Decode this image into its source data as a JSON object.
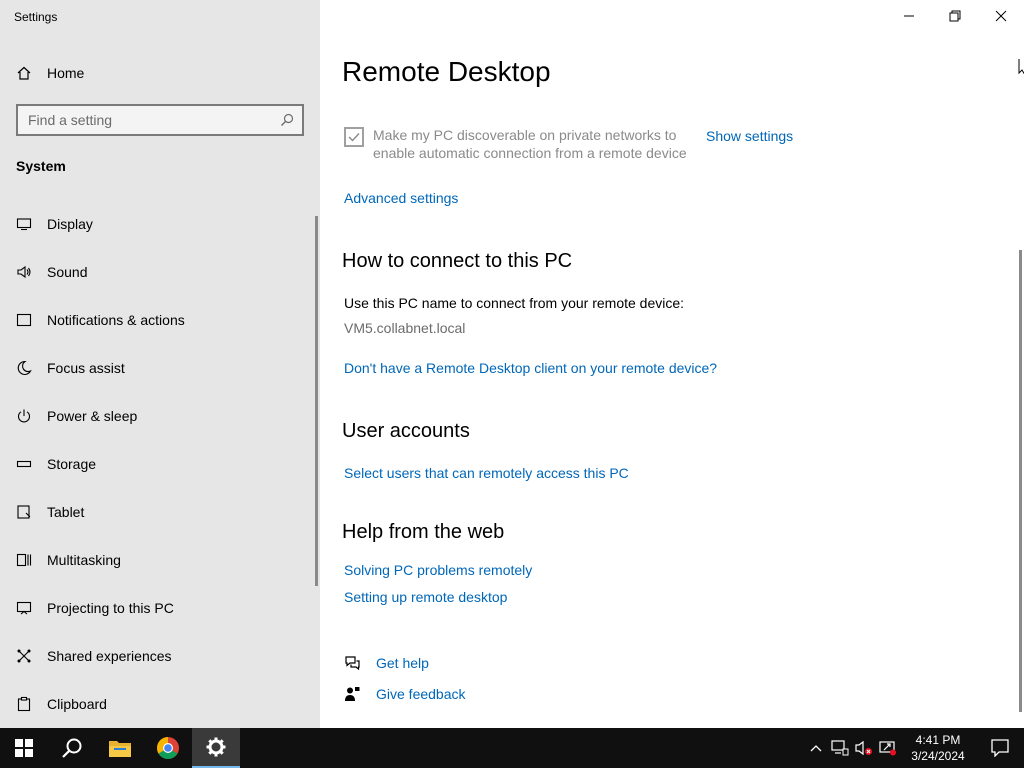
{
  "window": {
    "app_title": "Settings"
  },
  "sidebar": {
    "home_label": "Home",
    "search_placeholder": "Find a setting",
    "section_label": "System",
    "items": [
      {
        "label": "Display",
        "icon": "display-icon"
      },
      {
        "label": "Sound",
        "icon": "speaker-icon"
      },
      {
        "label": "Notifications & actions",
        "icon": "notification-icon"
      },
      {
        "label": "Focus assist",
        "icon": "moon-icon"
      },
      {
        "label": "Power & sleep",
        "icon": "power-icon"
      },
      {
        "label": "Storage",
        "icon": "storage-icon"
      },
      {
        "label": "Tablet",
        "icon": "tablet-icon"
      },
      {
        "label": "Multitasking",
        "icon": "multitasking-icon"
      },
      {
        "label": "Projecting to this PC",
        "icon": "projecting-icon"
      },
      {
        "label": "Shared experiences",
        "icon": "shared-experiences-icon"
      },
      {
        "label": "Clipboard",
        "icon": "clipboard-icon"
      }
    ]
  },
  "main": {
    "page_title": "Remote Desktop",
    "discoverable_checkbox": {
      "label": "Make my PC discoverable on private networks to enable automatic connection from a remote device",
      "checked": true,
      "disabled": true
    },
    "show_settings_link": "Show settings",
    "advanced_settings_link": "Advanced settings",
    "connect_section": {
      "heading": "How to connect to this PC",
      "instruction": "Use this PC name to connect from your remote device:",
      "pc_name": "VM5.collabnet.local",
      "client_link": "Don't have a Remote Desktop client on your remote device?"
    },
    "user_accounts_section": {
      "heading": "User accounts",
      "select_users_link": "Select users that can remotely access this PC"
    },
    "help_section": {
      "heading": "Help from the web",
      "links": [
        "Solving PC problems remotely",
        "Setting up remote desktop"
      ]
    },
    "get_help_label": "Get help",
    "give_feedback_label": "Give feedback"
  },
  "taskbar": {
    "apps": [
      "start-icon",
      "search-icon",
      "file-explorer-icon",
      "chrome-icon",
      "settings-icon"
    ],
    "clock_time": "4:41 PM",
    "clock_date": "3/24/2024"
  },
  "colors": {
    "accent_link": "#0067b8",
    "sidebar_bg": "#e6e6e6",
    "taskbar_bg": "#101010"
  }
}
